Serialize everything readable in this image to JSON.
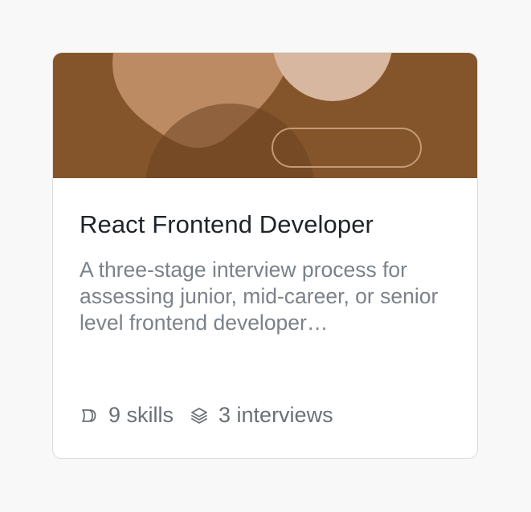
{
  "card": {
    "title": "React Frontend Developer",
    "description": "A three-stage interview process for assessing junior, mid-career, or senior level frontend developer…",
    "skills_label": "9 skills",
    "interviews_label": "3 interviews",
    "skills_icon": "skills-icon",
    "interviews_icon": "layers-icon"
  },
  "colors": {
    "banner_bg": "#84542a",
    "shape_light": "#d7b7a0",
    "shape_mid": "#bc8a63",
    "shape_dark": "#6b4220",
    "title": "#1f2428",
    "description": "#7b8289",
    "meta": "#6b7075"
  }
}
